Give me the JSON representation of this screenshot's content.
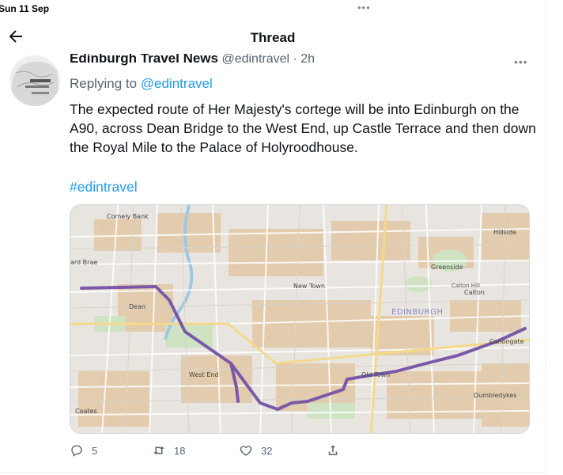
{
  "status_bar": {
    "date": "Sun 11 Sep",
    "dots": "•••"
  },
  "header": {
    "title": "Thread",
    "back_icon": "back-arrow-icon"
  },
  "tweet": {
    "author_name": "Edinburgh Travel News",
    "author_meta": " @edintravel · 2h",
    "more": "•••",
    "replying_to_prefix": "Replying to ",
    "replying_to_handle": "@edintravel",
    "text": "The expected route of Her Majesty's cortege will be into Edinburgh on the A90, across Dean Bridge to the West End, up Castle Terrace and then down the Royal Mile to the Palace of Holyroodhouse.",
    "hashtag": "#edintravel"
  },
  "map": {
    "route_color": "#7a5aa8",
    "labels": {
      "comely_bank": "Comely Bank",
      "hillside": "Hillside",
      "ard_brae": "ard Brae",
      "greenside": "Greenside",
      "calton_hill": "Calton Hill",
      "calton": "Calton",
      "new_town": "New Town",
      "dean": "Dean",
      "edinburgh": "EDINBURGH",
      "west_end": "West End",
      "canongate": "Canongate",
      "oldtown": "Old Town",
      "dumbiedykes": "Dumbiedykes",
      "coates": "Coates"
    }
  },
  "actions": {
    "replies": "5",
    "retweets": "18",
    "likes": "32"
  }
}
